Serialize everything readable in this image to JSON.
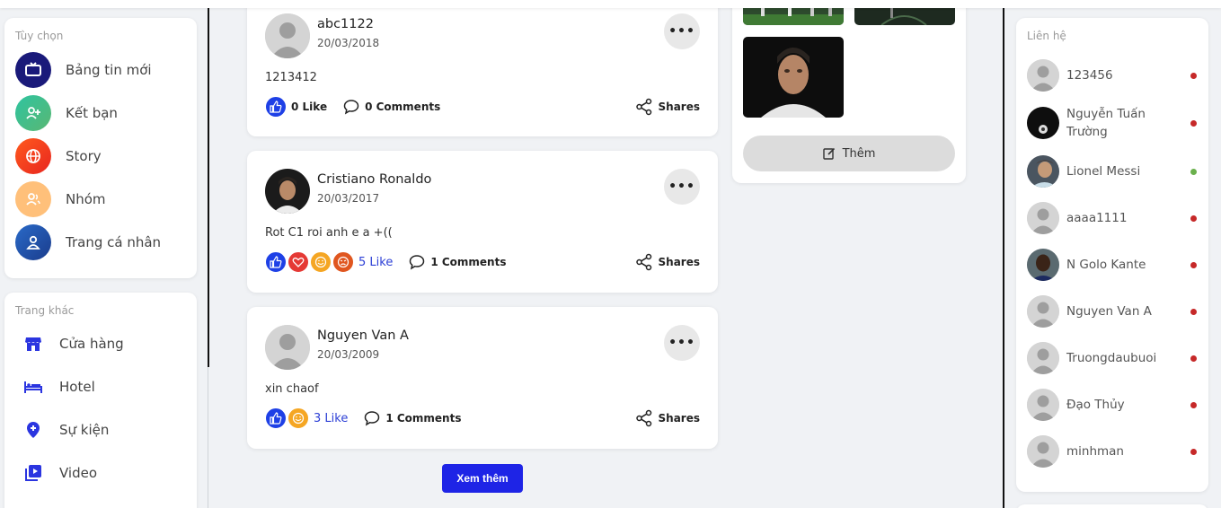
{
  "left_sidebar": {
    "options_title": "Tùy chọn",
    "options": [
      {
        "label": "Bảng tin mới",
        "icon": "tv-icon",
        "color": "#1a1a7a"
      },
      {
        "label": "Kết bạn",
        "icon": "add-friend-icon",
        "color": "#3dba8a"
      },
      {
        "label": "Story",
        "icon": "globe-icon",
        "color": "#f0391e"
      },
      {
        "label": "Nhóm",
        "icon": "group-icon",
        "color": "#ffc07a"
      },
      {
        "label": "Trang cá nhân",
        "icon": "user-icon",
        "color": "#1c4fa8"
      }
    ],
    "other_title": "Trang khác",
    "others": [
      {
        "label": "Cửa hàng",
        "icon": "store-icon"
      },
      {
        "label": "Hotel",
        "icon": "bed-icon"
      },
      {
        "label": "Sự kiện",
        "icon": "location-plus-icon"
      },
      {
        "label": "Video",
        "icon": "video-icon"
      }
    ]
  },
  "posts": [
    {
      "name": "abc1122",
      "date": "20/03/2018",
      "text": "1213412",
      "likes": "0 Like",
      "comments": "0 Comments",
      "shares": "Shares",
      "reactions": [
        "like"
      ],
      "avatar": "default"
    },
    {
      "name": "Cristiano Ronaldo",
      "date": "20/03/2017",
      "text": "Rot C1 roi anh e a +((",
      "likes": "5 Like",
      "comments": "1 Comments",
      "shares": "Shares",
      "reactions": [
        "like",
        "love",
        "haha",
        "angry"
      ],
      "avatar": "photo"
    },
    {
      "name": "Nguyen Van A",
      "date": "20/03/2009",
      "text": "xin chaof",
      "likes": "3 Like",
      "comments": "1 Comments",
      "shares": "Shares",
      "reactions": [
        "like",
        "haha"
      ],
      "avatar": "default"
    }
  ],
  "load_more": "Xem thêm",
  "photos_panel": {
    "more_label": "Thêm"
  },
  "contacts": {
    "title": "Liên hệ",
    "items": [
      {
        "name": "123456",
        "status": "offline",
        "avatar": "default"
      },
      {
        "name": "Nguyễn Tuấn Trường",
        "status": "offline",
        "avatar": "dark"
      },
      {
        "name": "Lionel Messi",
        "status": "online",
        "avatar": "photo"
      },
      {
        "name": "aaaa1111",
        "status": "offline",
        "avatar": "default"
      },
      {
        "name": "N Golo Kante",
        "status": "offline",
        "avatar": "photo"
      },
      {
        "name": "Nguyen Van A",
        "status": "offline",
        "avatar": "default"
      },
      {
        "name": "Truongdaubuoi",
        "status": "offline",
        "avatar": "default"
      },
      {
        "name": "Đạo Thủy",
        "status": "offline",
        "avatar": "default"
      },
      {
        "name": "minhman",
        "status": "offline",
        "avatar": "default"
      }
    ],
    "colors": {
      "online": "#6ab04c",
      "offline": "#c62828"
    }
  },
  "colors": {
    "accent": "#1e24e6",
    "like": "#1e40e6",
    "love": "#e53935",
    "haha": "#f5a623",
    "angry": "#e0561f"
  }
}
